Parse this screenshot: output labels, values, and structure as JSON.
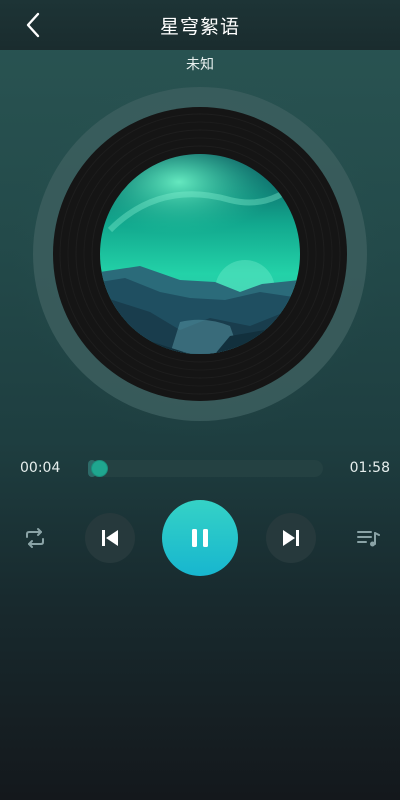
{
  "header": {
    "title": "星穹絮语",
    "back_icon": "chevron-left-icon"
  },
  "track": {
    "artist": "未知"
  },
  "progress": {
    "current_time": "00:04",
    "total_time": "01:58",
    "fraction": 0.034
  },
  "controls": {
    "repeat_icon": "repeat-icon",
    "previous_icon": "skip-previous-icon",
    "play_pause_icon": "pause-icon",
    "next_icon": "skip-next-icon",
    "playlist_icon": "playlist-icon"
  },
  "colors": {
    "accent": "#1fb8c9",
    "progress_thumb": "#1fa68f"
  }
}
